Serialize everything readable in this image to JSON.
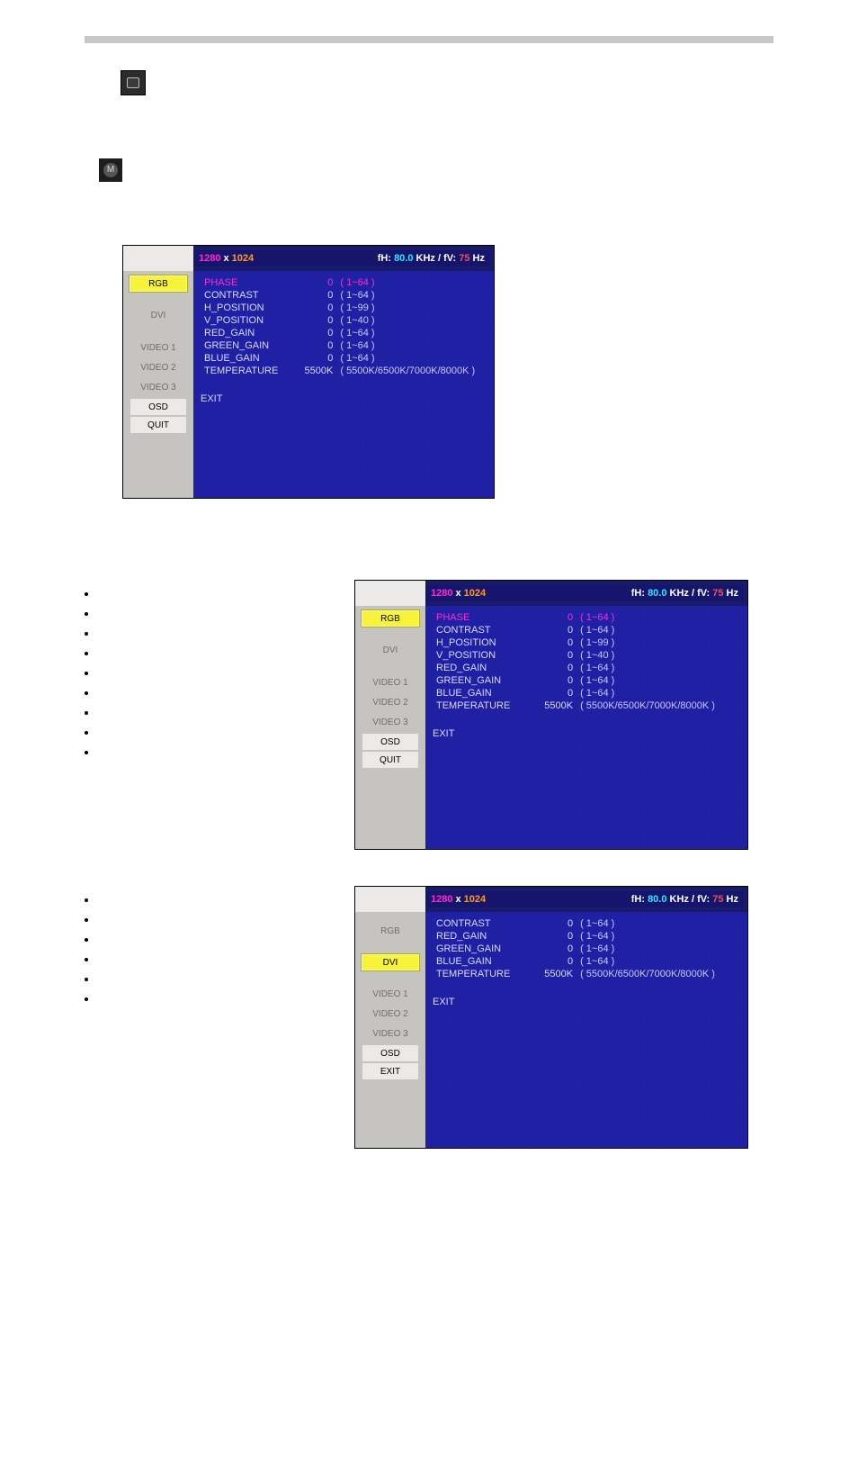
{
  "osd_common": {
    "res_w": "1280",
    "res_h": "1024",
    "freq_label_fh": "fH:",
    "freq_khz": "80.0",
    "freq_unit_khz": "KHz / fV:",
    "freq_hz": "75",
    "freq_unit_hz": "Hz"
  },
  "sidebar_items": {
    "rgb": "RGB",
    "dvi": "DVI",
    "v1": "VIDEO 1",
    "v2": "VIDEO 2",
    "v3": "VIDEO 3",
    "osd": "OSD",
    "quit": "QUIT",
    "exit": "EXIT"
  },
  "rgb_menu": [
    {
      "label": "PHASE",
      "value": "0",
      "range": "( 1~64 )",
      "selected": true
    },
    {
      "label": "CONTRAST",
      "value": "0",
      "range": "( 1~64 )"
    },
    {
      "label": "H_POSITION",
      "value": "0",
      "range": "( 1~99 )"
    },
    {
      "label": "V_POSITION",
      "value": "0",
      "range": "( 1~40 )"
    },
    {
      "label": "RED_GAIN",
      "value": "0",
      "range": "( 1~64 )"
    },
    {
      "label": "GREEN_GAIN",
      "value": "0",
      "range": "( 1~64 )"
    },
    {
      "label": "BLUE_GAIN",
      "value": "0",
      "range": "( 1~64 )"
    },
    {
      "label": "TEMPERATURE",
      "value": "5500K",
      "range": "( 5500K/6500K/7000K/8000K )"
    }
  ],
  "rgb_exit": "EXIT",
  "dvi_menu": [
    {
      "label": "CONTRAST",
      "value": "0",
      "range": "( 1~64 )"
    },
    {
      "label": "RED_GAIN",
      "value": "0",
      "range": "( 1~64 )"
    },
    {
      "label": "GREEN_GAIN",
      "value": "0",
      "range": "( 1~64 )"
    },
    {
      "label": "BLUE_GAIN",
      "value": "0",
      "range": "( 1~64 )"
    },
    {
      "label": "TEMPERATURE",
      "value": "5500K",
      "range": "( 5500K/6500K/7000K/8000K )"
    }
  ],
  "dvi_exit": "EXIT",
  "bullets_rgb_count": 9,
  "bullets_dvi_count": 6
}
